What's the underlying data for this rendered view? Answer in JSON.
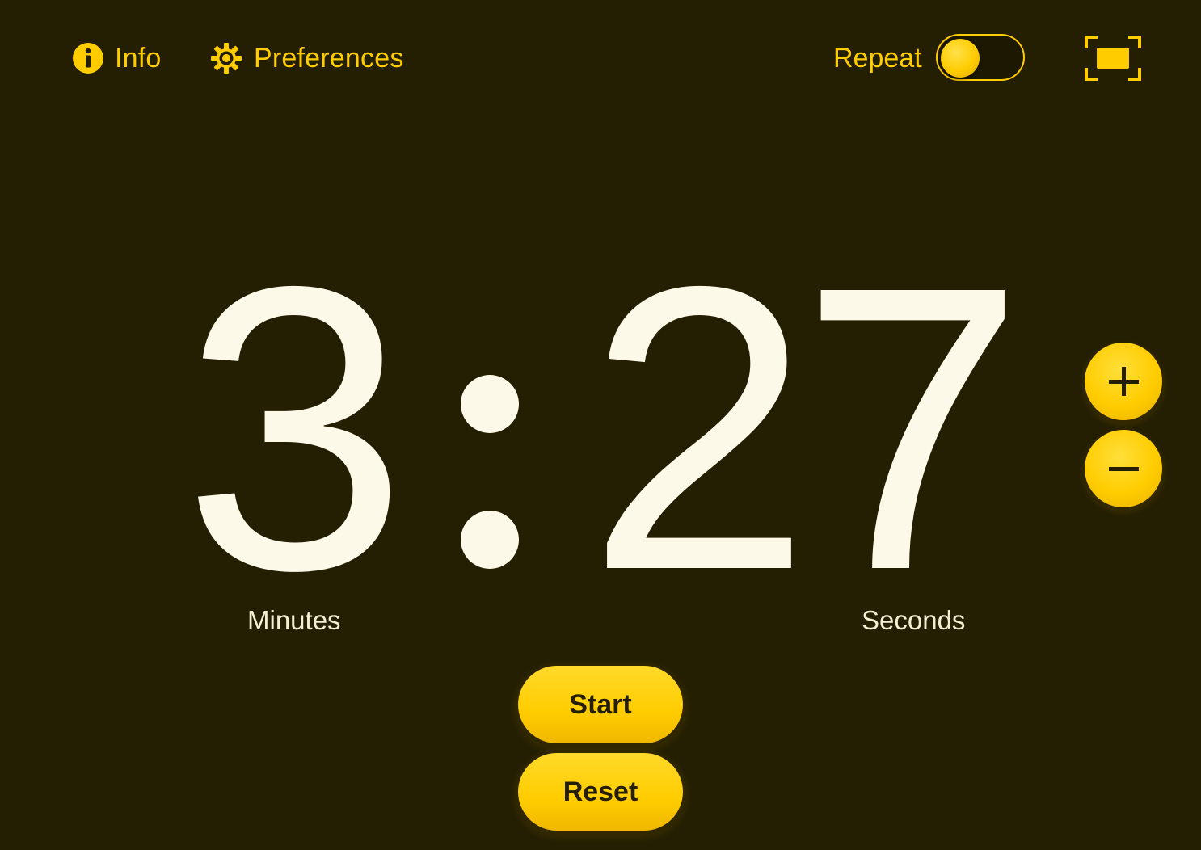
{
  "header": {
    "info_label": "Info",
    "info_icon": "info-circle-icon",
    "preferences_label": "Preferences",
    "preferences_icon": "gear-icon",
    "repeat_label": "Repeat",
    "repeat_enabled": false,
    "fullscreen_icon": "fullscreen-icon"
  },
  "timer": {
    "minutes": "3",
    "seconds": "27",
    "minutes_label": "Minutes",
    "seconds_label": "Seconds"
  },
  "adjust": {
    "increase_icon": "plus-icon",
    "decrease_icon": "minus-icon"
  },
  "controls": {
    "start_label": "Start",
    "reset_label": "Reset"
  },
  "colors": {
    "background": "#241e03",
    "accent": "#ffcc00",
    "digits": "#fdf9e9",
    "button_text": "#241e03"
  }
}
